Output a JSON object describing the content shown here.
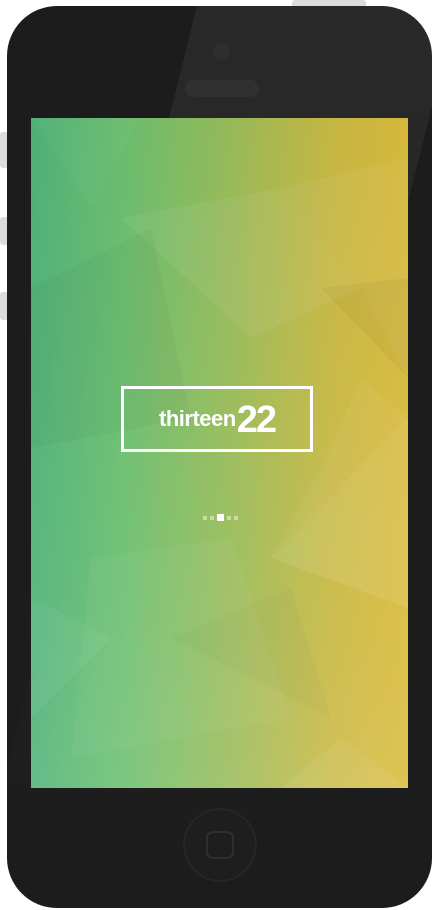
{
  "splash": {
    "logo_word": "thirteen",
    "logo_number": "22",
    "loader": {
      "dot_count": 5,
      "active_index": 2
    }
  },
  "colors": {
    "gradient_left": "#4fb378",
    "gradient_right": "#d9bb3c",
    "logo": "#ffffff",
    "device_body": "#1c1c1c"
  },
  "icons": {
    "home_button": "rounded-square"
  }
}
